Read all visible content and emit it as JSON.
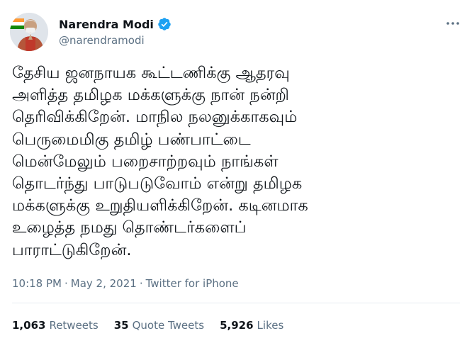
{
  "author": {
    "display_name": "Narendra Modi",
    "handle": "@narendramodi",
    "verified": true,
    "verified_color": "#1da1f2"
  },
  "tweet": {
    "lines": [
      "தேசிய ஜனநாயக கூட்டணிக்கு ஆதரவு",
      "அளித்த தமிழக மக்களுக்கு நான் நன்றி",
      "தெரிவிக்கிறேன். மாநில நலனுக்காகவும்",
      "பெருமைமிகு தமிழ் பண்பாட்டை",
      "மென்மேலும் பறைசாற்றவும் நாங்கள்",
      "தொடர்ந்து பாடுபடுவோம் என்று தமிழக",
      "மக்களுக்கு உறுதியளிக்கிறேன். கடினமாக",
      "உழைத்த நமது தொண்டர்களைப்",
      "பாராட்டுகிறேன்."
    ]
  },
  "meta": {
    "time": "10:18 PM",
    "separator": "·",
    "date": "May 2, 2021",
    "source": "Twitter for iPhone"
  },
  "stats": {
    "retweets_count": "1,063",
    "retweets_label": "Retweets",
    "quotes_count": "35",
    "quotes_label": "Quote Tweets",
    "likes_count": "5,926",
    "likes_label": "Likes"
  },
  "colors": {
    "text": "#0f1419",
    "secondary": "#5b7083",
    "divider": "#e6ecf0"
  }
}
